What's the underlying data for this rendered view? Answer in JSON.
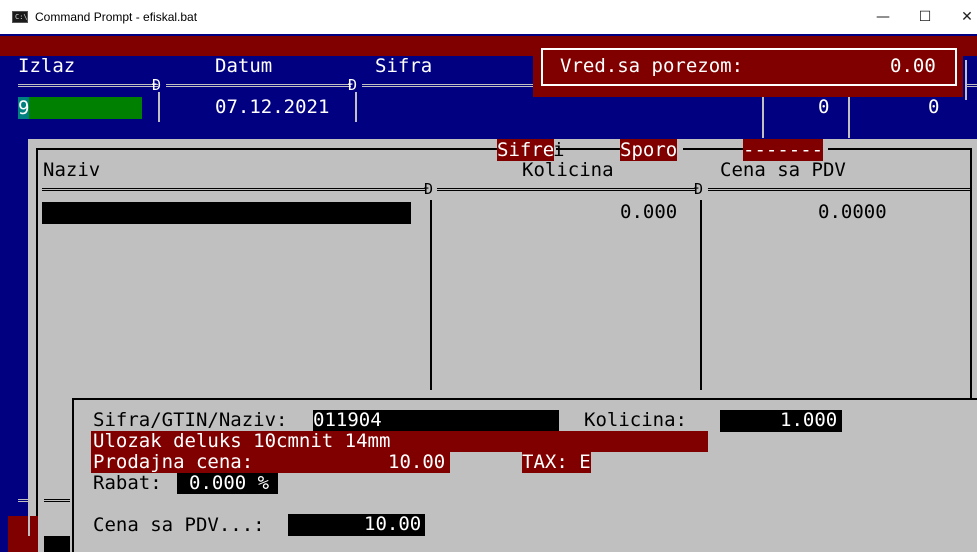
{
  "window": {
    "title": "Command Prompt - efiskal.bat",
    "icon_label": "C:\\",
    "minimize_glyph": "—",
    "maximize_glyph": "☐",
    "close_glyph": "✕"
  },
  "header": {
    "col_izlaz": "Izlaz",
    "col_datum": "Datum",
    "col_sifra": "Sifra",
    "izlaz_value": "9",
    "datum_value": "07.12.2021",
    "count1": "0",
    "count2": "0",
    "divider_glyph": "Ð"
  },
  "total_box": {
    "label": "Vred.sa porezom:",
    "value": "0.00"
  },
  "tabs": [
    "Sifre",
    "Sporo",
    "-------"
  ],
  "tab_cursor": "i",
  "table": {
    "col_naziv": "Naziv",
    "col_kolicina": "Kolicina",
    "col_cena": "Cena sa PDV",
    "row_kolicina": "0.000",
    "row_cena": "0.0000"
  },
  "entry": {
    "sifra_label": "Sifra/GTIN/Naziv:",
    "sifra_value": "011904",
    "kolicina_label": "Kolicina:",
    "kolicina_value": "1.000",
    "product_name": "Ulozak deluks 10cmnit 14mm",
    "prodajna_label": "Prodajna cena:",
    "prodajna_value": "10.00",
    "tax_label": "TAX: E",
    "rabat_label": "Rabat:",
    "rabat_value": "0.000 %",
    "cena_pdv_label": "Cena sa PDV...:",
    "cena_pdv_value": "10.00"
  },
  "colors": {
    "console_blue": "#000080",
    "console_gray": "#c0c0c0",
    "highlight_red": "#800000",
    "input_green": "#008000"
  }
}
